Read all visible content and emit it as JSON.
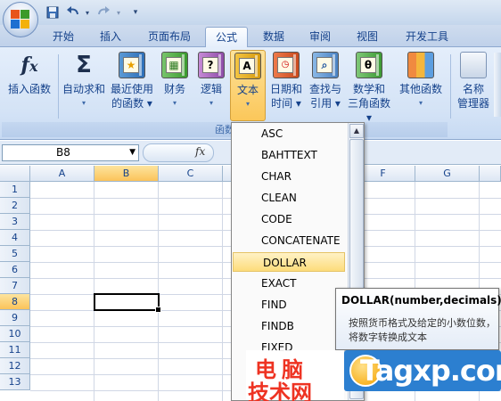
{
  "colors": {
    "accent": "#15428b",
    "ribbon_bg": "#dbe7f7",
    "highlight": "#fddc7b",
    "watermark_red": "#e32222",
    "watermark_blue": "#2c7fd0"
  },
  "qat": {
    "save_icon": "save-icon",
    "undo_icon": "undo-icon",
    "redo_icon": "redo-icon",
    "customize_icon": "qat-dropdown-icon"
  },
  "tabs": [
    "开始",
    "插入",
    "页面布局",
    "公式",
    "数据",
    "审阅",
    "视图",
    "开发工具"
  ],
  "ribbon": {
    "active_tab": "公式",
    "group_label": "函数",
    "buttons": [
      {
        "line1": "插入函数",
        "line2": "",
        "icon": "fx-icon"
      },
      {
        "line1": "自动求和",
        "line2": "▾",
        "icon": "sigma-icon"
      },
      {
        "line1": "最近使用",
        "line2": "的函数 ▾",
        "icon": "recent-book-icon"
      },
      {
        "line1": "财务",
        "line2": "▾",
        "icon": "financial-book-icon"
      },
      {
        "line1": "逻辑",
        "line2": "▾",
        "icon": "logical-book-icon"
      },
      {
        "line1": "文本",
        "line2": "▾",
        "icon": "text-book-icon"
      },
      {
        "line1": "日期和",
        "line2": "时间 ▾",
        "icon": "date-book-icon"
      },
      {
        "line1": "查找与",
        "line2": "引用 ▾",
        "icon": "lookup-book-icon"
      },
      {
        "line1": "数学和",
        "line2": "三角函数 ▾",
        "icon": "math-book-icon"
      },
      {
        "line1": "其他函数",
        "line2": "▾",
        "icon": "more-book-icon"
      },
      {
        "line1": "名称",
        "line2": "管理器",
        "icon": "name-manager-icon"
      }
    ]
  },
  "formula_bar": {
    "name_box": "B8",
    "fx": "fx"
  },
  "grid": {
    "columns": [
      "A",
      "B",
      "C",
      "D",
      "E",
      "F",
      "G"
    ],
    "rows": [
      "1",
      "2",
      "3",
      "4",
      "5",
      "6",
      "7",
      "8",
      "9",
      "10",
      "11",
      "12",
      "13"
    ],
    "selected_column": "B",
    "selected_row": "8"
  },
  "dropdown": {
    "items": [
      "ASC",
      "BAHTTEXT",
      "CHAR",
      "CLEAN",
      "CODE",
      "CONCATENATE",
      "DOLLAR",
      "EXACT",
      "FIND",
      "FINDB",
      "FIXED"
    ],
    "highlighted": "DOLLAR"
  },
  "tooltip": {
    "title": "DOLLAR(number,decimals)",
    "description": "按照货币格式及给定的小数位数，将数字转换成文本"
  },
  "watermark": {
    "cn_line1": "电脑",
    "cn_line2": "技术网",
    "site": "Tagxp.com"
  }
}
